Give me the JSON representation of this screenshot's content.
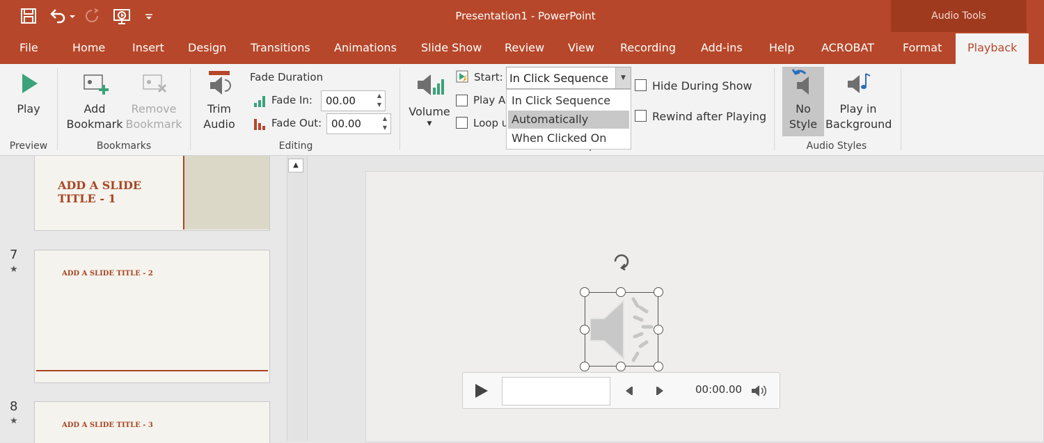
{
  "window": {
    "title": "Presentation1  -  PowerPoint",
    "context_title": "Audio Tools"
  },
  "colors": {
    "accent": "#b7472a",
    "context_band": "#9f3a1f",
    "slide_title": "#a74522"
  },
  "qat": {
    "icons": [
      "save-icon",
      "undo-icon",
      "redo-icon",
      "start-from-beginning-icon",
      "customize-qat-icon"
    ]
  },
  "tabs": [
    "File",
    "Home",
    "Insert",
    "Design",
    "Transitions",
    "Animations",
    "Slide Show",
    "Review",
    "View",
    "Recording",
    "Add-ins",
    "Help",
    "ACROBAT",
    "Format",
    "Playback"
  ],
  "active_tab": "Playback",
  "ribbon": {
    "preview": {
      "play": "Play",
      "group": "Preview"
    },
    "bookmarks": {
      "add_line1": "Add",
      "add_line2": "Bookmark",
      "remove_line1": "Remove",
      "remove_line2": "Bookmark",
      "group": "Bookmarks"
    },
    "editing": {
      "trim_line1": "Trim",
      "trim_line2": "Audio",
      "fade_duration": "Fade Duration",
      "fade_in_label": "Fade In:",
      "fade_in_value": "00.00",
      "fade_out_label": "Fade Out:",
      "fade_out_value": "00.00",
      "group": "Editing"
    },
    "audio_options": {
      "volume": "Volume",
      "start_label": "Start:",
      "start_value": "In Click Sequence",
      "play_across": "Play A",
      "loop": "Loop u",
      "hide_during_show": "Hide During Show",
      "rewind_after_playing": "Rewind after Playing",
      "group": "Audio Options",
      "start_options": [
        "In Click Sequence",
        "Automatically",
        "When Clicked On"
      ],
      "highlighted_option": "Automatically"
    },
    "audio_styles": {
      "no_style_line1": "No",
      "no_style_line2": "Style",
      "play_bg_line1": "Play in",
      "play_bg_line2": "Background",
      "group": "Audio Styles"
    }
  },
  "slides": [
    {
      "title_line1": "ADD A SLIDE",
      "title_line2": "TITLE - 1"
    },
    {
      "number": "7",
      "title": "ADD A SLIDE TITLE - 2",
      "star": "★"
    },
    {
      "number": "8",
      "title": "ADD A SLIDE TITLE - 3",
      "star": "★"
    }
  ],
  "player": {
    "time": "00:00.00",
    "icons": [
      "play-icon",
      "seek-back-icon",
      "seek-forward-icon",
      "speaker-icon"
    ]
  }
}
